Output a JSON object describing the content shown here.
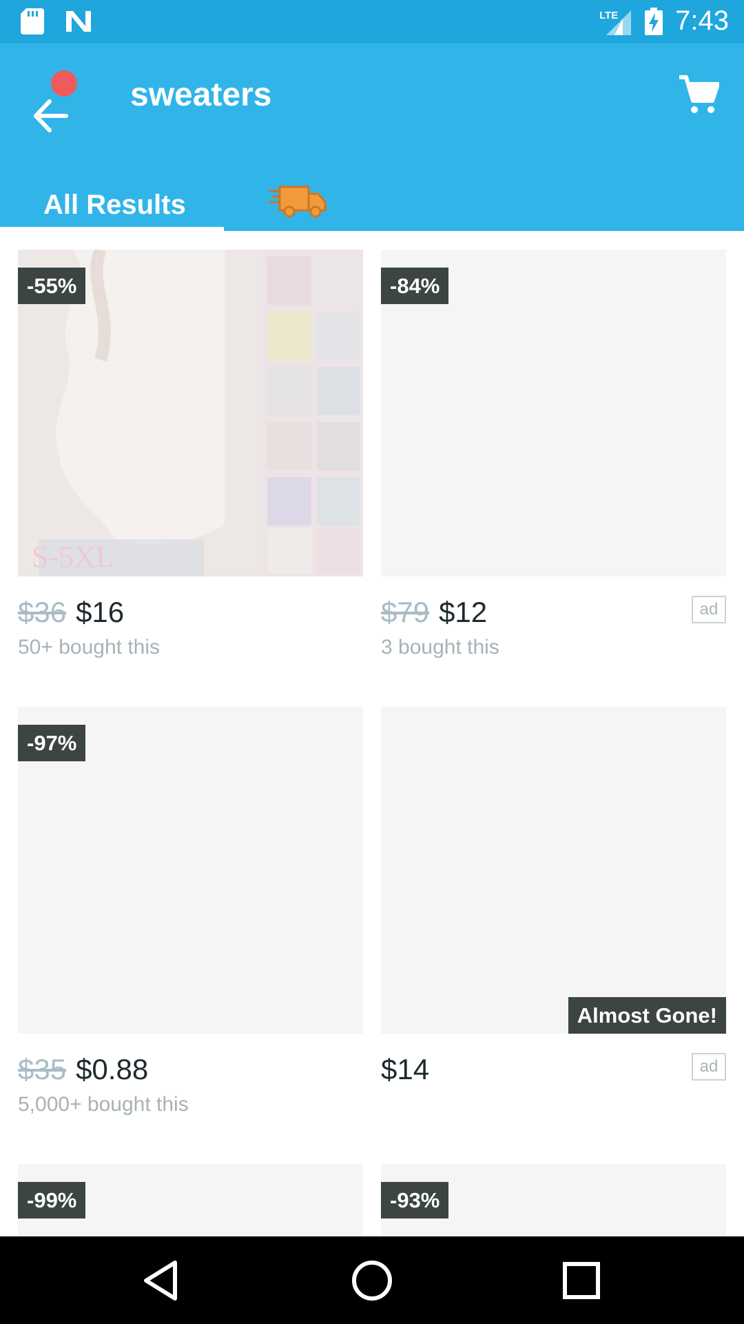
{
  "status_bar": {
    "time": "7:43",
    "network": "LTE",
    "icons": [
      "sd-card-icon",
      "n-notification-icon",
      "lte-signal-icon",
      "battery-charging-icon"
    ]
  },
  "header": {
    "title": "sweaters",
    "back_icon": "arrow-left-icon",
    "cart_icon": "cart-icon",
    "accent_color": "#31b5e9",
    "notification_dot_color": "#ef5a5a"
  },
  "tabs": [
    {
      "label": "All Results",
      "selected": true
    },
    {
      "label": "",
      "icon": "delivery-truck-icon",
      "selected": false
    }
  ],
  "products": [
    {
      "discount": "-55%",
      "old_price": "$36",
      "price": "$16",
      "bought": "50+ bought this",
      "ad": "",
      "badge": "",
      "image_text": "S-5XL"
    },
    {
      "discount": "-84%",
      "old_price": "$79",
      "price": "$12",
      "bought": "3 bought this",
      "ad": "ad",
      "badge": ""
    },
    {
      "discount": "-97%",
      "old_price": "$35",
      "price": "$0.88",
      "bought": "5,000+ bought this",
      "ad": "",
      "badge": ""
    },
    {
      "discount": "",
      "old_price": "",
      "price": "$14",
      "bought": "",
      "ad": "ad",
      "badge": "Almost Gone!"
    },
    {
      "discount": "-99%"
    },
    {
      "discount": "-93%"
    }
  ],
  "nav": {
    "back_icon": "triangle-back-icon",
    "home_icon": "circle-home-icon",
    "recents_icon": "square-recents-icon"
  }
}
